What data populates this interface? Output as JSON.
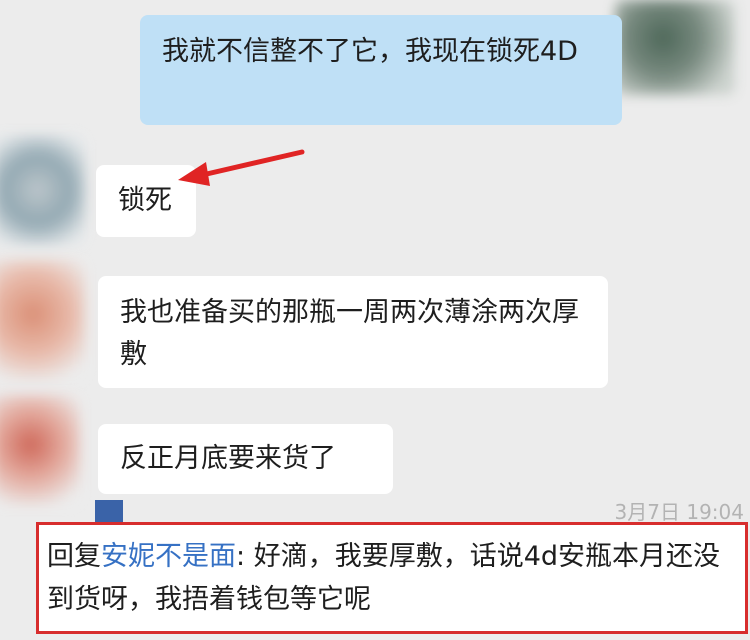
{
  "messages": [
    {
      "id": "m1",
      "sender": "self",
      "text": "我就不信整不了它，我现在锁死4D"
    },
    {
      "id": "m2",
      "sender": "other",
      "text": "锁死"
    },
    {
      "id": "m3",
      "sender": "other",
      "text": "我也准备买的那瓶一周两次薄涂两次厚敷"
    },
    {
      "id": "m4",
      "sender": "other",
      "text": "反正月底要来货了"
    }
  ],
  "timestamp": "3月7日 19:04",
  "reply": {
    "prefix": "回复",
    "name": "安妮不是面",
    "separator": ":",
    "text": " 好滴，我要厚敷，话说4d安瓶本月还没到货呀，我捂着钱包等它呢"
  },
  "colors": {
    "self_bubble": "#bfe0f6",
    "other_bubble": "#ffffff",
    "highlight": "#d72d2d",
    "reply_name": "#3671c4"
  }
}
